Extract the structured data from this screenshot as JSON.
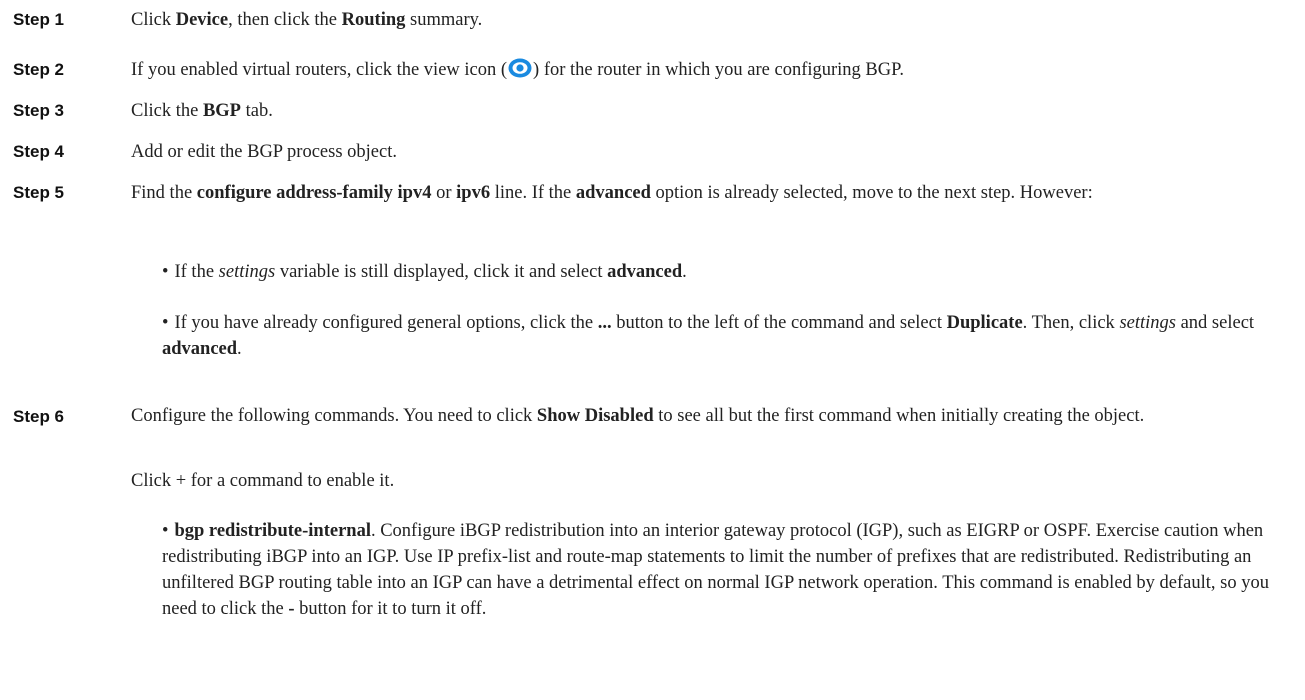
{
  "steps": [
    {
      "label": "Step 1"
    },
    {
      "label": "Step 2"
    },
    {
      "label": "Step 3"
    },
    {
      "label": "Step 4"
    },
    {
      "label": "Step 5"
    },
    {
      "label": "Step 6"
    }
  ],
  "s1": {
    "a": "Click ",
    "b": "Device",
    "c": ", then click the ",
    "d": "Routing",
    "e": " summary."
  },
  "s2": {
    "a": "If you enabled virtual routers, click the view icon (",
    "b": ") for the router in which you are configuring BGP."
  },
  "s3": {
    "a": "Click the ",
    "b": "BGP",
    "c": " tab."
  },
  "s4": {
    "a": "Add or edit the BGP process object."
  },
  "s5": {
    "a": "Find the ",
    "b": "configure address-family ipv4",
    "c": " or ",
    "d": "ipv6",
    "e": " line. If the ",
    "f": "advanced",
    "g": " option is already selected, move to the next step. However:",
    "bullet1": {
      "a": "If the ",
      "b": "settings",
      "c": " variable is still displayed, click it and select ",
      "d": "advanced",
      "e": "."
    },
    "bullet2": {
      "a": "If you have already configured general options, click the ",
      "b": "...",
      "c": " button to the left of the command and select ",
      "d": "Duplicate",
      "e": ". Then, click ",
      "f": "settings",
      "g": " and select ",
      "h": "advanced",
      "i": "."
    }
  },
  "s6": {
    "a": "Configure the following commands. You need to click ",
    "b": "Show Disabled",
    "c": " to see all but the first command when initially creating the object.",
    "p2": "Click + for a command to enable it.",
    "bullet1": {
      "a": "bgp redistribute-internal",
      "b": ". Configure iBGP redistribution into an interior gateway protocol (IGP), such as EIGRP or OSPF. Exercise caution when redistributing iBGP into an IGP. Use IP prefix-list and route-map statements to limit the number of prefixes that are redistributed. Redistributing an unfiltered BGP routing table into an IGP can have a detrimental effect on normal IGP network operation. This command is enabled by default, so you need to click the ",
      "c": "-",
      "d": " button for it to turn it off."
    }
  },
  "bullet_char": "•",
  "icons": {
    "view_icon": "eye-view-icon",
    "view_icon_color": "#1a8ae0"
  }
}
